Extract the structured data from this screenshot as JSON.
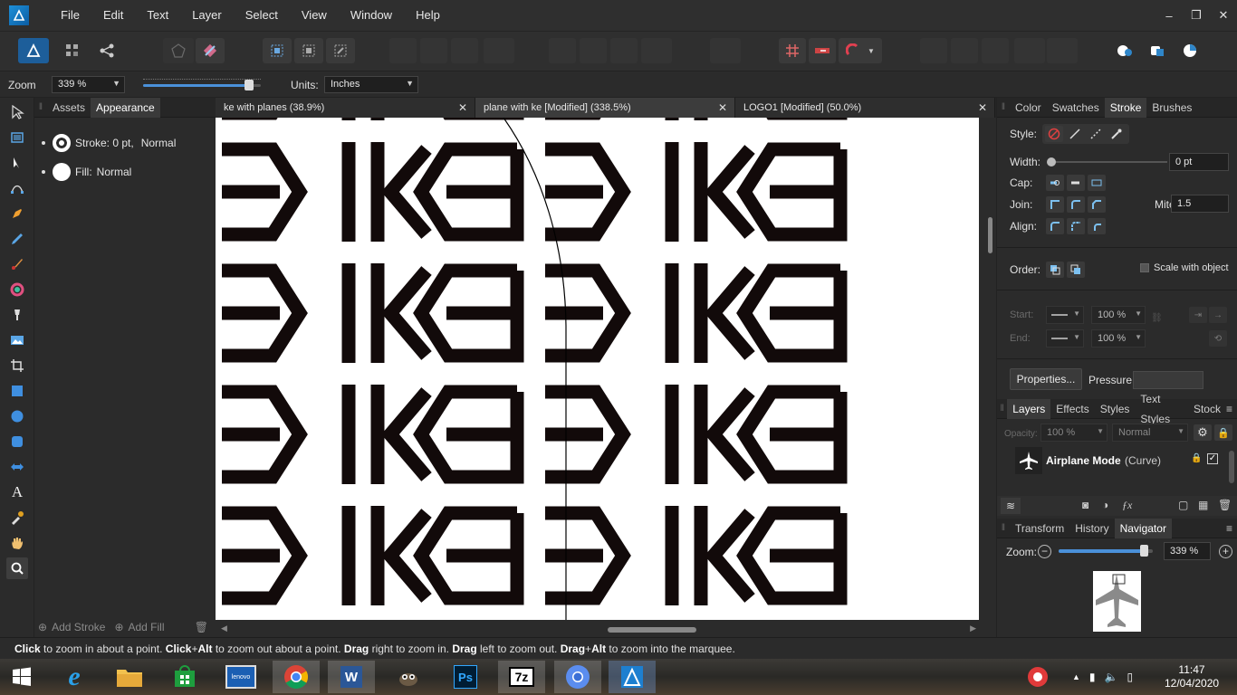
{
  "menu": {
    "items": [
      "File",
      "Edit",
      "Text",
      "Layer",
      "Select",
      "View",
      "Window",
      "Help"
    ],
    "window_controls": [
      "–",
      "❐",
      "✕"
    ]
  },
  "context": {
    "zoom_label": "Zoom",
    "zoom_value": "339 %",
    "zoom_slider_level": 0.9,
    "units_label": "Units:",
    "units_value": "Inches"
  },
  "left_panel": {
    "tabs": [
      "Assets",
      "Appearance"
    ],
    "active_tab": "Appearance",
    "stroke_label": "Stroke: 0 pt,",
    "stroke_mode": "Normal",
    "fill_label": "Fill:",
    "fill_mode": "Normal",
    "add_stroke": "Add Stroke",
    "add_fill": "Add Fill"
  },
  "document_tabs": [
    {
      "label": "ke with planes (38.9%)",
      "active": false
    },
    {
      "label": "plane with ke [Modified] (338.5%)",
      "active": true
    },
    {
      "label": "LOGO1 [Modified] (50.0%)",
      "active": false
    }
  ],
  "canvas": {
    "pattern_rows": 4,
    "pattern_cols": 2,
    "tile_glyph": "EKKE"
  },
  "right_panel": {
    "top_tabs": [
      "Color",
      "Swatches",
      "Stroke",
      "Brushes"
    ],
    "active_top_tab": "Stroke",
    "style_label": "Style:",
    "width_label": "Width:",
    "width_value": "0 pt",
    "cap_label": "Cap:",
    "join_label": "Join:",
    "miter_label": "Miter:",
    "miter_value": "1.5",
    "align_label": "Align:",
    "order_label": "Order:",
    "scale_with_object": "Scale with object",
    "start_label": "Start:",
    "end_label": "End:",
    "start_pct": "100 %",
    "end_pct": "100 %",
    "properties_button": "Properties...",
    "pressure_label": "Pressure:",
    "layers_tabs": [
      "Layers",
      "Effects",
      "Styles",
      "Text Styles",
      "Stock"
    ],
    "active_layers_tab": "Layers",
    "opacity_label": "Opacity:",
    "opacity_value": "100 %",
    "blend_value": "Normal",
    "layer_name": "Airplane Mode",
    "layer_type": "(Curve)",
    "nav_tabs": [
      "Transform",
      "History",
      "Navigator"
    ],
    "active_nav_tab": "Navigator",
    "nav_zoom_label": "Zoom:",
    "nav_zoom_value": "339 %",
    "nav_zoom_level": 0.9
  },
  "status": {
    "parts": [
      {
        "b": "Click"
      },
      {
        "t": " to zoom in about a point. "
      },
      {
        "b": "Click"
      },
      {
        "t": "+"
      },
      {
        "b": "Alt"
      },
      {
        "t": " to zoom out about a point. "
      },
      {
        "b": "Drag"
      },
      {
        "t": " right to zoom in. "
      },
      {
        "b": "Drag"
      },
      {
        "t": " left to zoom out. "
      },
      {
        "b": "Drag"
      },
      {
        "t": "+"
      },
      {
        "b": "Alt"
      },
      {
        "t": " to zoom into the marquee."
      }
    ]
  },
  "taskbar": {
    "apps": [
      "start",
      "internet-explorer",
      "file-explorer",
      "store",
      "lenovo",
      "chrome",
      "word",
      "gimp",
      "photoshop",
      "7zip",
      "chromium",
      "affinity-designer"
    ],
    "active_app": "affinity-designer",
    "lenovo_label": "lenovo",
    "ps_label": "Ps",
    "word_label": "W",
    "sevenzip_label": "7z",
    "time": "11:47",
    "date": "12/04/2020"
  },
  "colors": {
    "accent": "#4a90d9",
    "artboard": "#ffffff",
    "pattern": "#120a0a",
    "ui_bg": "#2b2b2b"
  }
}
